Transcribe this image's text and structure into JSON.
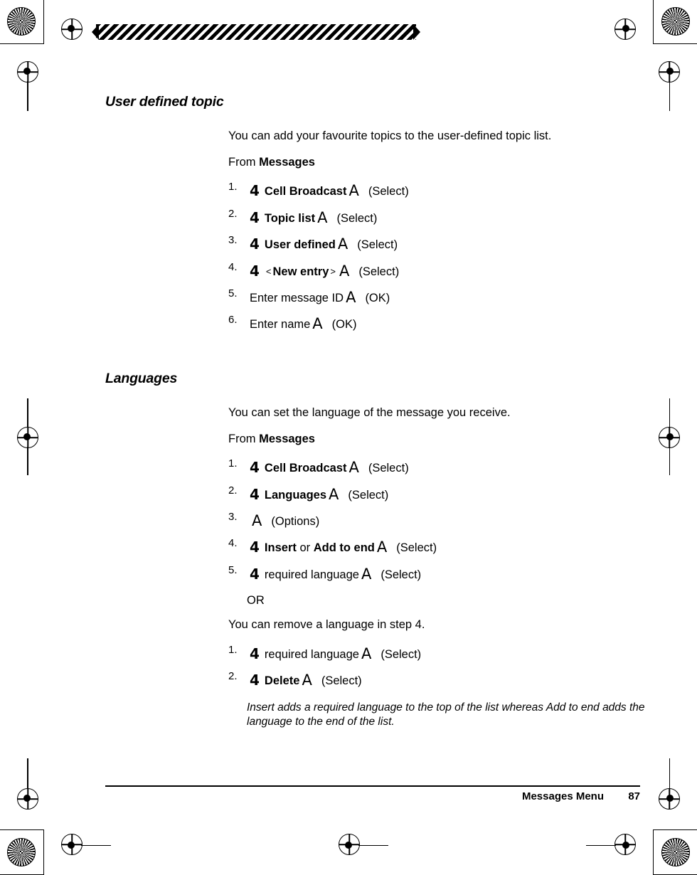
{
  "page": {
    "sections": [
      {
        "heading": "User defined topic",
        "intro": "You can add your favourite topics to the user-defined topic list.",
        "from_prefix": "From ",
        "from_target": "Messages",
        "steps": [
          {
            "num": "1.",
            "scroll": "4",
            "bold": "Cell Broadcast",
            "plain": "",
            "key": "A",
            "action": "(Select)"
          },
          {
            "num": "2.",
            "scroll": "4",
            "bold": "Topic list",
            "plain": "",
            "key": "A",
            "action": "(Select)"
          },
          {
            "num": "3.",
            "scroll": "4",
            "bold": "User defined",
            "plain": "",
            "key": "A",
            "action": "(Select)"
          },
          {
            "num": "4.",
            "scroll": "4",
            "bracket_open": "<",
            "bold": "New entry",
            "bracket_close": ">",
            "key": "A",
            "action": "(Select)"
          },
          {
            "num": "5.",
            "scroll": "",
            "bold": "",
            "plain": "Enter message ID",
            "key": "A",
            "action": "(OK)"
          },
          {
            "num": "6.",
            "scroll": "",
            "bold": "",
            "plain": "Enter name",
            "key": "A",
            "action": "(OK)"
          }
        ]
      },
      {
        "heading": "Languages",
        "intro": "You can set the language of the message you receive.",
        "from_prefix": "From ",
        "from_target": "Messages",
        "steps": [
          {
            "num": "1.",
            "scroll": "4",
            "bold": "Cell Broadcast",
            "plain": "",
            "key": "A",
            "action": "(Select)"
          },
          {
            "num": "2.",
            "scroll": "4",
            "bold": "Languages",
            "plain": "",
            "key": "A",
            "action": "(Select)"
          },
          {
            "num": "3.",
            "scroll": "",
            "bold": "",
            "plain": "",
            "key": "A",
            "action": "(Options)"
          },
          {
            "num": "4.",
            "scroll": "4",
            "bold": "Insert",
            "mid": " or ",
            "bold2": "Add to end",
            "plain": "",
            "key": "A",
            "action": "(Select)"
          },
          {
            "num": "5.",
            "scroll": "4",
            "bold": "",
            "plain": "required language",
            "key": "A",
            "action": "(Select)"
          }
        ],
        "or_label": "OR",
        "after_or": "You can remove a language in step 4.",
        "steps2": [
          {
            "num": "1.",
            "scroll": "4",
            "bold": "",
            "plain": "required language",
            "key": "A",
            "action": "(Select)"
          },
          {
            "num": "2.",
            "scroll": "4",
            "bold": "Delete",
            "plain": "",
            "key": "A",
            "action": "(Select)"
          }
        ],
        "note": "Insert adds a required language to the top of the list whereas Add to end adds the language to the end of the list."
      }
    ],
    "footer": {
      "title": "Messages Menu",
      "page_number": "87"
    }
  }
}
